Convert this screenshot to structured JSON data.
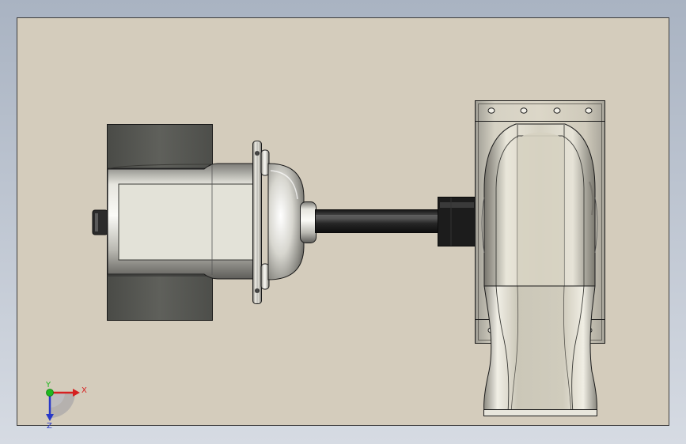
{
  "viewport": {
    "background_top": "#a9b3c2",
    "background_bottom": "#d6dbe3"
  },
  "sheet": {
    "fill": "#d4ccbc",
    "border": "#3c3c3c"
  },
  "model": {
    "components": [
      "motor-end-cap",
      "motor-body",
      "motor-mounting-flange",
      "motor-front-dome",
      "drive-shaft",
      "shaft-coupling",
      "blower-housing",
      "blower-outlet-duct"
    ],
    "colors": {
      "metal_light": "#ecebe4",
      "metal_mid": "#b2b1aa",
      "metal_dark": "#6e6d68",
      "end_cap": "#565753",
      "label_panel": "#e3e2d8",
      "shaft": "#2a2a2a",
      "coupling": "#1c1c1c",
      "outline": "#1a1a1a"
    }
  },
  "triad": {
    "x_label": "X",
    "y_label": "Y",
    "z_label": "Z",
    "x_color": "#d62020",
    "y_color": "#1fb81f",
    "z_color": "#2838c8"
  }
}
